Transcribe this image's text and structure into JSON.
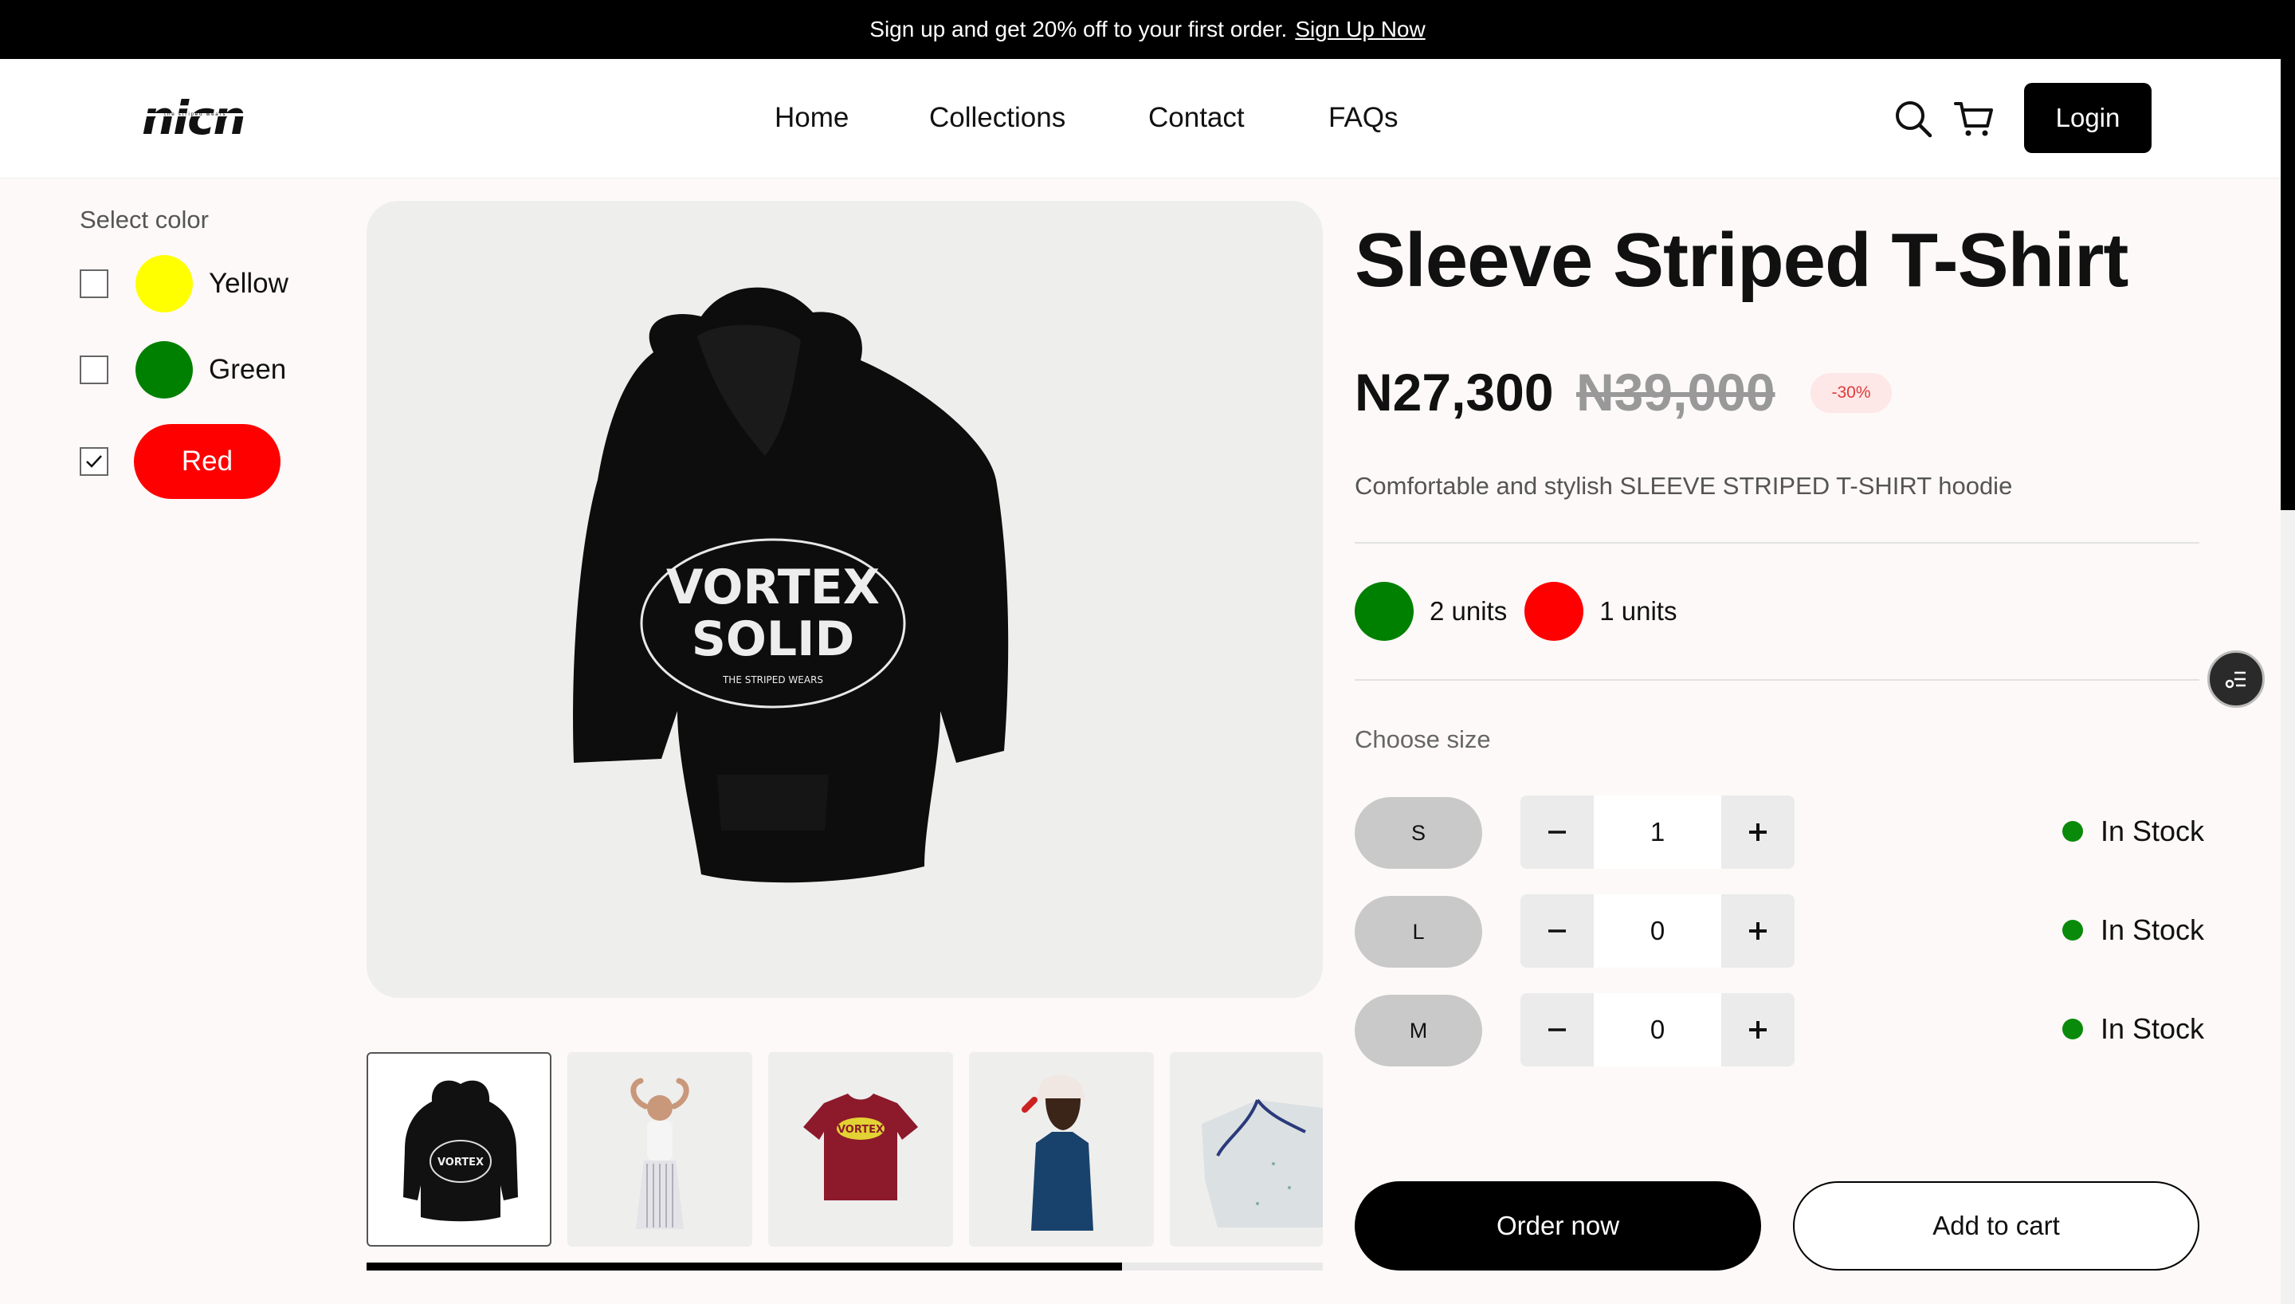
{
  "promo": {
    "text": "Sign up and get 20% off to your first order.",
    "link": "Sign Up Now"
  },
  "header": {
    "logo": "nicn",
    "logo_tagline": "the striped wears",
    "nav": [
      "Home",
      "Collections",
      "Contact",
      "FAQs"
    ],
    "login_label": "Login",
    "icons": [
      "search-icon",
      "cart-icon"
    ]
  },
  "filters": {
    "title": "Select color",
    "colors": [
      {
        "label": "Yellow",
        "color": "#ffff00",
        "checked": false
      },
      {
        "label": "Green",
        "color": "#008000",
        "checked": false
      },
      {
        "label": "Red",
        "color": "#ff0000",
        "checked": true
      }
    ]
  },
  "gallery": {
    "main_print_top": "VORTEX",
    "main_print_bottom": "SOLID",
    "main_print_tag": "THE STRIPED WEARS",
    "thumb_print": "VORTEX",
    "slider_progress": 0.79
  },
  "product": {
    "title": "Sleeve Striped T-Shirt",
    "price": "N27,300",
    "old_price": "N39,000",
    "discount": "-30%",
    "description": "Comfortable and stylish SLEEVE STRIPED T-SHIRT hoodie",
    "stock": [
      {
        "color": "#008000",
        "label": "2 units"
      },
      {
        "color": "#ff0000",
        "label": "1 units"
      }
    ],
    "size_title": "Choose size",
    "sizes": [
      {
        "size": "S",
        "qty": "1",
        "status": "In Stock"
      },
      {
        "size": "L",
        "qty": "0",
        "status": "In Stock"
      },
      {
        "size": "M",
        "qty": "0",
        "status": "In Stock"
      }
    ],
    "order_label": "Order now",
    "cart_label": "Add to cart"
  },
  "colors": {
    "accent": "#000000",
    "stock_green": "#0a8a0a",
    "discount_bg": "#fde7e7",
    "discount_text": "#e03a3a"
  }
}
